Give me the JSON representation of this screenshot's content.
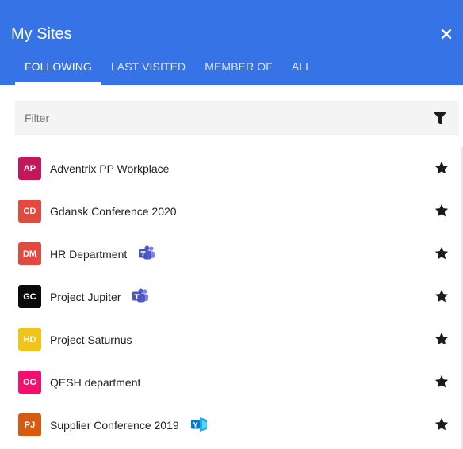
{
  "header": {
    "title": "My Sites",
    "color": "#3573e6",
    "tabs": [
      {
        "label": "FOLLOWING",
        "active": true
      },
      {
        "label": "LAST VISITED",
        "active": false
      },
      {
        "label": "MEMBER OF",
        "active": false
      },
      {
        "label": "ALL",
        "active": false
      }
    ]
  },
  "filter": {
    "placeholder": "Filter",
    "value": ""
  },
  "sites": [
    {
      "initials": "AP",
      "name": "Adventrix PP Workplace",
      "color": "#c2185b",
      "app": null,
      "starred": true
    },
    {
      "initials": "CD",
      "name": "Gdansk Conference 2020",
      "color": "#e04a3f",
      "app": null,
      "starred": true
    },
    {
      "initials": "DM",
      "name": "HR Department",
      "color": "#e04a3f",
      "app": "teams-icon",
      "starred": true
    },
    {
      "initials": "GC",
      "name": "Project Jupiter",
      "color": "#0a0a0a",
      "app": "teams-icon",
      "starred": true
    },
    {
      "initials": "HD",
      "name": "Project Saturnus",
      "color": "#f0c419",
      "app": null,
      "starred": true
    },
    {
      "initials": "OG",
      "name": "QESH department",
      "color": "#f0106e",
      "app": null,
      "starred": true
    },
    {
      "initials": "PJ",
      "name": "Supplier Conference 2019",
      "color": "#d75a10",
      "app": "yammer-icon",
      "starred": true
    }
  ]
}
